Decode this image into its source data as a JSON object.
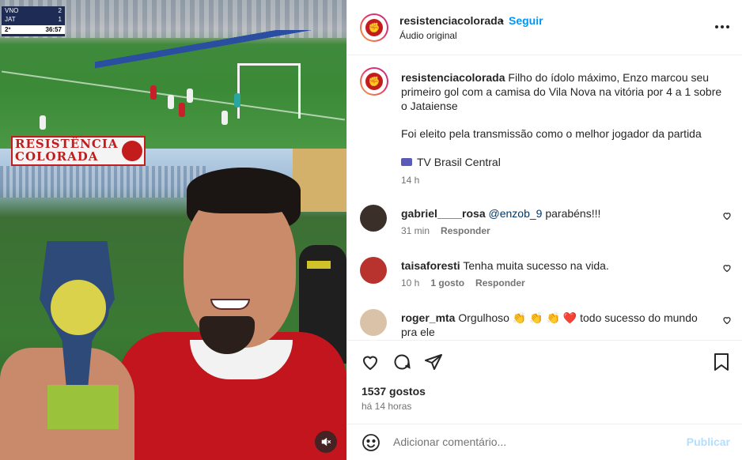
{
  "media": {
    "scorebug": {
      "home": "VNO",
      "home_score": "2",
      "away": "JAT",
      "away_score": "1",
      "period": "2º",
      "clock": "36:57"
    },
    "watermark_line1": "RESISTÊNCIA",
    "watermark_line2": "COLORADA",
    "mute_icon": "speaker-muted-icon"
  },
  "header": {
    "username": "resistenciacolorada",
    "separator": "•",
    "follow_label": "Seguir",
    "audio_label": "Áudio original",
    "more_icon": "more-horizontal-icon"
  },
  "caption": {
    "username": "resistenciacolorada",
    "text": "Filho do ídolo máximo, Enzo marcou seu primeiro gol com a camisa do Vila Nova na vitória por 4 a 1 sobre o Jataiense",
    "line2": "Foi eleito pela transmissão como o melhor jogador da partida",
    "line3": "TV Brasil Central",
    "time": "14 h"
  },
  "comments": [
    {
      "username": "gabriel____rosa",
      "mention": "@enzob_9",
      "text": " parabéns!!!",
      "time": "31 min",
      "likes": "",
      "reply": "Responder",
      "avatar_color": "#3b2f2a"
    },
    {
      "username": "taisaforesti",
      "mention": "",
      "text": "Tenha muita sucesso na vida.",
      "time": "10 h",
      "likes": "1 gosto",
      "reply": "Responder",
      "avatar_color": "#b8322e"
    },
    {
      "username": "roger_mta",
      "mention": "",
      "text": "Orgulhoso 👏 👏 👏 ❤️ todo sucesso do mundo pra ele",
      "time": "",
      "likes": "",
      "reply": "",
      "avatar_color": "#d9c2a8"
    }
  ],
  "actions": {
    "likes": "1537 gostos",
    "ago": "há 14 horas"
  },
  "composer": {
    "placeholder": "Adicionar comentário...",
    "publish_label": "Publicar"
  },
  "colors": {
    "link_blue": "#0095f6",
    "publish_disabled": "#b2dffc",
    "brand_red": "#c21c1c"
  }
}
